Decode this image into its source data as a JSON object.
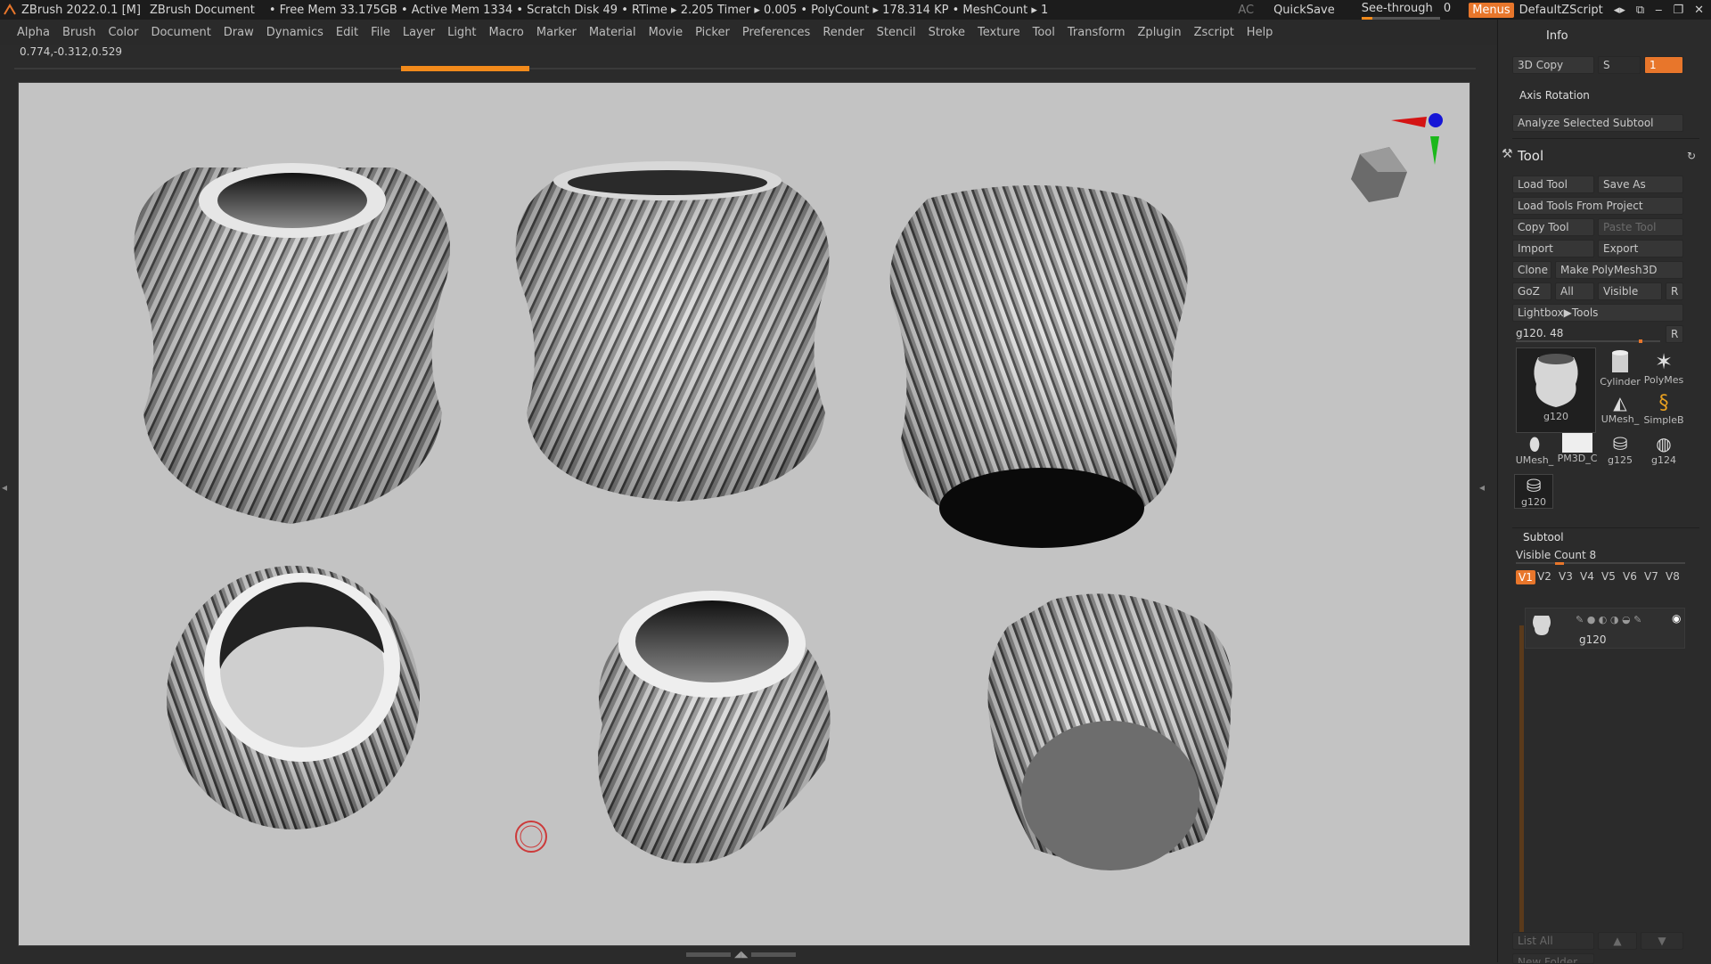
{
  "titlebar": {
    "app": "ZBrush 2022.0.1 [M]",
    "document": "ZBrush Document",
    "stats": "• Free Mem 33.175GB • Active Mem 1334 • Scratch Disk 49 •  RTime ▸ 2.205 Timer ▸ 0.005 • PolyCount ▸ 178.314 KP  • MeshCount ▸ 1",
    "ac": "AC",
    "quicksave": "QuickSave",
    "see_through_label": "See-through",
    "see_through_value": "0",
    "menus": "Menus",
    "script": "DefaultZScript"
  },
  "menubar": [
    "Alpha",
    "Brush",
    "Color",
    "Document",
    "Draw",
    "Dynamics",
    "Edit",
    "File",
    "Layer",
    "Light",
    "Macro",
    "Marker",
    "Material",
    "Movie",
    "Picker",
    "Preferences",
    "Render",
    "Stencil",
    "Stroke",
    "Texture",
    "Tool",
    "Transform",
    "Zplugin",
    "Zscript",
    "Help"
  ],
  "coord": "0.774,-0.312,0.529",
  "progress_fraction": 0.09,
  "rightpanel": {
    "info": "Info",
    "copy3d": "3D Copy",
    "s_label": "S",
    "s_value": "1",
    "axis_rotation": "Axis Rotation",
    "analyze": "Analyze Selected Subtool",
    "tool_title": "Tool",
    "load_tool": "Load Tool",
    "save_as": "Save As",
    "load_from_project": "Load Tools From Project",
    "copy_tool": "Copy Tool",
    "paste_tool": "Paste Tool",
    "import": "Import",
    "export": "Export",
    "clone": "Clone",
    "make_polymesh": "Make PolyMesh3D",
    "goz": "GoZ",
    "all": "All",
    "visible": "Visible",
    "r": "R",
    "lightbox": "Lightbox▶Tools",
    "current_tool": "g120. 48",
    "thumbs": {
      "big": "g120",
      "cylinder": "Cylinder",
      "polymesh": "PolyMes",
      "umesh1": "UMesh_",
      "simpleb": "SimpleB",
      "umesh2": "UMesh_",
      "pm3d": "PM3D_C",
      "g125": "g125",
      "g124": "g124",
      "g120b": "g120"
    },
    "subtool": "Subtool",
    "visible_count": "Visible Count 8",
    "vtabs": [
      "V1",
      "V2",
      "V3",
      "V4",
      "V5",
      "V6",
      "V7",
      "V8"
    ],
    "subtool_item": "g120",
    "list_all": "List All",
    "new_folder": "New Folder"
  }
}
